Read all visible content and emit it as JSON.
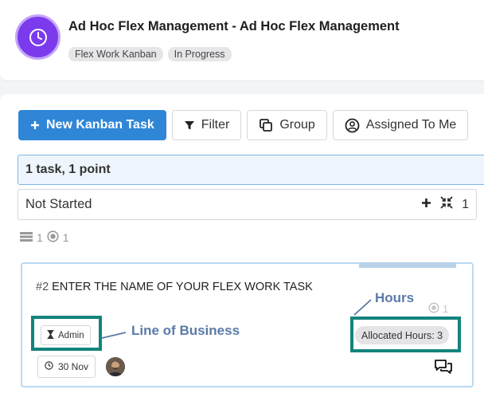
{
  "header": {
    "title": "Ad Hoc Flex Management - Ad Hoc Flex Management",
    "badges": [
      "Flex Work Kanban",
      "In Progress"
    ],
    "icon": "clock-icon",
    "accent": "#7c3aed"
  },
  "toolbar": {
    "new_task": "New Kanban Task",
    "filter": "Filter",
    "group": "Group",
    "assigned": "Assigned To Me",
    "primary_color": "#2f86d6"
  },
  "summary": "1 task, 1 point",
  "group_row": {
    "label": "Not Started",
    "count": "1"
  },
  "stats": {
    "tasks": "1",
    "points": "1"
  },
  "card": {
    "number": "#2",
    "title": "ENTER THE NAME OF YOUR FLEX WORK TASK",
    "points": "1",
    "tag": "Admin",
    "allocated_hours": "Allocated Hours: 3",
    "date": "30 Nov"
  },
  "annotations": {
    "line_of_business": "Line of Business",
    "hours": "Hours",
    "highlight_color": "#14847c"
  }
}
